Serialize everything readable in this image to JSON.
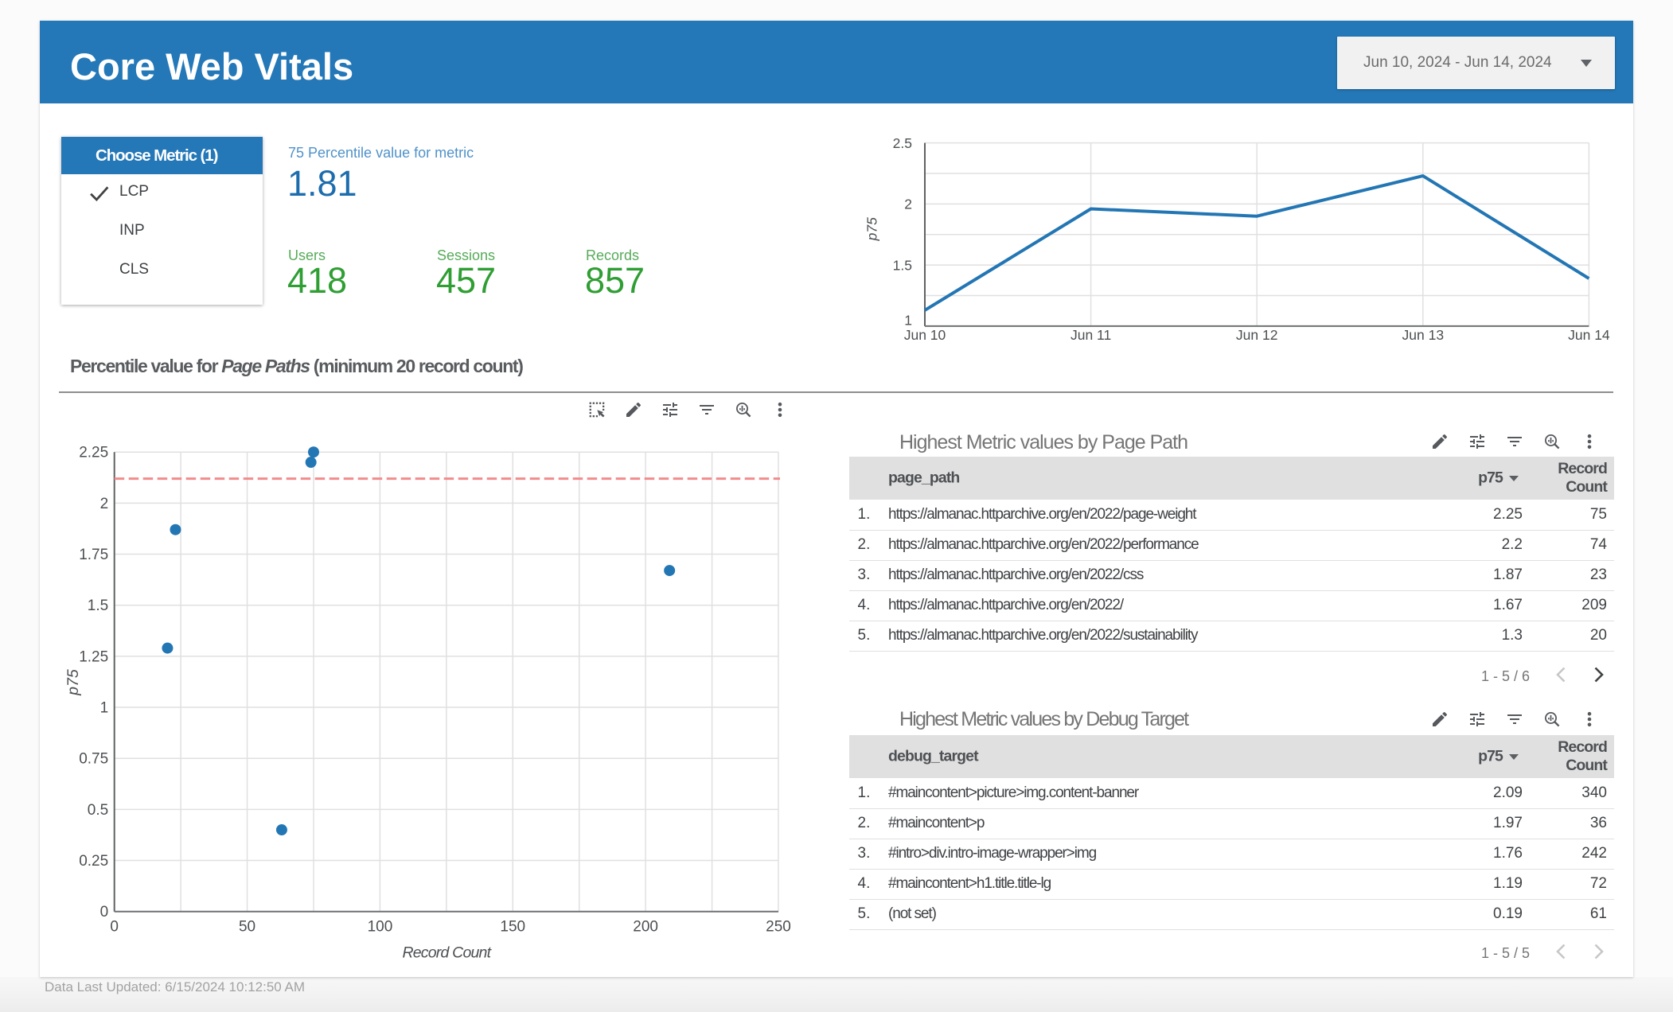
{
  "page": {
    "title": "Core Web Vitals",
    "date_range": "Jun 10, 2024 - Jun 14, 2024",
    "footer": "Data Last Updated: 6/15/2024 10:12:50 AM"
  },
  "colors": {
    "header_blue": "#2478b8",
    "label_blue": "#4f92c9",
    "value_blue": "#1c6cae",
    "label_green": "#56ab59",
    "value_green": "#2f9e33",
    "series_blue": "#2376b4",
    "reference_red": "#f28b8b",
    "table_header_gray": "#e0e0e0"
  },
  "metric_selector": {
    "header": "Choose Metric (1)",
    "options": [
      {
        "label": "LCP",
        "selected": true
      },
      {
        "label": "INP",
        "selected": false
      },
      {
        "label": "CLS",
        "selected": false
      }
    ]
  },
  "scorecards": {
    "percentile": {
      "label": "75 Percentile value for metric",
      "value": "1.81"
    },
    "kpis": [
      {
        "label": "Users",
        "value": "418"
      },
      {
        "label": "Sessions",
        "value": "457"
      },
      {
        "label": "Records",
        "value": "857"
      }
    ]
  },
  "section": {
    "prefix": "Percentile value for ",
    "emphasis": "Page Paths",
    "suffix": " (minimum 20 record count)"
  },
  "chart_data": [
    {
      "type": "line",
      "title": "p75 trend by date",
      "x": [
        "Jun 10",
        "Jun 11",
        "Jun 12",
        "Jun 13",
        "Jun 14"
      ],
      "series": [
        {
          "name": "p75",
          "values": [
            1.13,
            1.96,
            1.9,
            2.23,
            1.39
          ]
        }
      ],
      "xlabel": "",
      "ylabel": "p75",
      "ylim": [
        1,
        2.5
      ],
      "yticks": [
        1,
        1.5,
        2,
        2.5
      ],
      "minor_step": 0.25,
      "grid": true,
      "legend_position": "none"
    },
    {
      "type": "scatter",
      "title": "Percentile value for Page Paths (minimum 20 record count)",
      "points": [
        {
          "x": 75,
          "y": 2.25
        },
        {
          "x": 74,
          "y": 2.2
        },
        {
          "x": 23,
          "y": 1.87
        },
        {
          "x": 209,
          "y": 1.67
        },
        {
          "x": 20,
          "y": 1.29
        },
        {
          "x": 63,
          "y": 0.4
        }
      ],
      "xlabel": "Record Count",
      "ylabel": "p75",
      "xlim": [
        0,
        250
      ],
      "ylim": [
        0,
        2.25
      ],
      "xticks": [
        0,
        50,
        100,
        150,
        200,
        250
      ],
      "x_minor_step": 25,
      "y_minor_step": 0.25,
      "reference_line_y": 2.12,
      "grid": true
    }
  ],
  "tables": [
    {
      "title": "Highest Metric values by Page Path",
      "columns": [
        "page_path",
        "p75",
        "Record Count"
      ],
      "rows": [
        {
          "idx": "1.",
          "dim": "https://almanac.httparchive.org/en/2022/page-weight",
          "p75": "2.25",
          "count": "75"
        },
        {
          "idx": "2.",
          "dim": "https://almanac.httparchive.org/en/2022/performance",
          "p75": "2.2",
          "count": "74"
        },
        {
          "idx": "3.",
          "dim": "https://almanac.httparchive.org/en/2022/css",
          "p75": "1.87",
          "count": "23"
        },
        {
          "idx": "4.",
          "dim": "https://almanac.httparchive.org/en/2022/",
          "p75": "1.67",
          "count": "209"
        },
        {
          "idx": "5.",
          "dim": "https://almanac.httparchive.org/en/2022/sustainability",
          "p75": "1.3",
          "count": "20"
        }
      ],
      "pagination": "1 - 5 / 6",
      "prev_enabled": false,
      "next_enabled": true
    },
    {
      "title": "Highest Metric values by Debug Target",
      "columns": [
        "debug_target",
        "p75",
        "Record Count"
      ],
      "rows": [
        {
          "idx": "1.",
          "dim": "#maincontent>picture>img.content-banner",
          "p75": "2.09",
          "count": "340"
        },
        {
          "idx": "2.",
          "dim": "#maincontent>p",
          "p75": "1.97",
          "count": "36"
        },
        {
          "idx": "3.",
          "dim": "#intro>div.intro-image-wrapper>img",
          "p75": "1.76",
          "count": "242"
        },
        {
          "idx": "4.",
          "dim": "#maincontent>h1.title.title-lg",
          "p75": "1.19",
          "count": "72"
        },
        {
          "idx": "5.",
          "dim": "(not set)",
          "p75": "0.19",
          "count": "61"
        }
      ],
      "pagination": "1 - 5 / 5",
      "prev_enabled": false,
      "next_enabled": false
    }
  ],
  "toolbars": {
    "chart_tools": [
      "marquee-select",
      "edit",
      "tune",
      "filter",
      "zoom-insights",
      "more-vert"
    ],
    "table_tools": [
      "edit",
      "tune",
      "filter",
      "zoom-insights",
      "more-vert"
    ]
  }
}
